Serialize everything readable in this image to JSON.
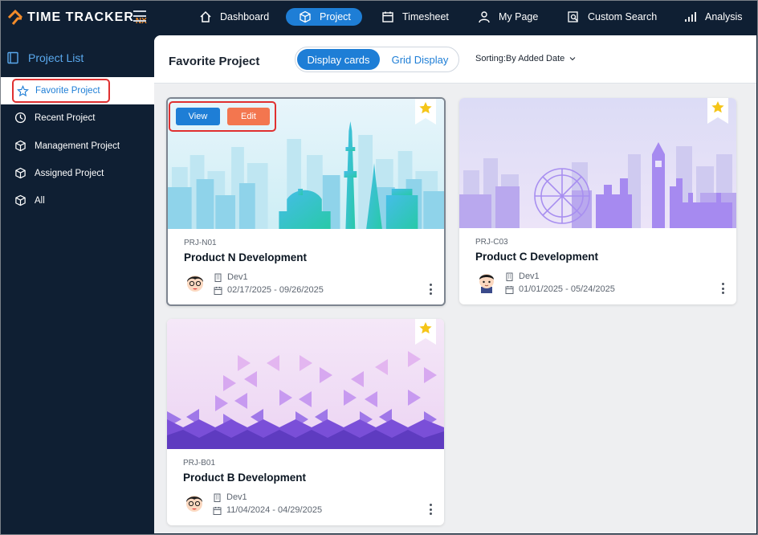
{
  "app": {
    "logo_text": "TIME TRACKER",
    "logo_suffix": "NX"
  },
  "nav": {
    "items": [
      {
        "label": "Dashboard",
        "icon": "home-icon"
      },
      {
        "label": "Project",
        "icon": "cube-icon",
        "active": true
      },
      {
        "label": "Timesheet",
        "icon": "calendar-icon"
      },
      {
        "label": "My Page",
        "icon": "user-icon"
      },
      {
        "label": "Custom Search",
        "icon": "search-doc-icon"
      },
      {
        "label": "Analysis",
        "icon": "bar-chart-icon"
      }
    ]
  },
  "sidebar": {
    "title": "Project List",
    "items": [
      {
        "label": "Favorite Project",
        "icon": "star-icon",
        "active": true
      },
      {
        "label": "Recent Project",
        "icon": "clock-icon"
      },
      {
        "label": "Management Project",
        "icon": "cube-icon"
      },
      {
        "label": "Assigned Project",
        "icon": "cube-icon"
      },
      {
        "label": "All",
        "icon": "cube-icon"
      }
    ]
  },
  "main": {
    "title": "Favorite Project",
    "view_toggle": {
      "active": "Display cards",
      "inactive": "Grid Display"
    },
    "sorting": "Sorting:By Added Date"
  },
  "cards": [
    {
      "code": "PRJ-N01",
      "name": "Product N Development",
      "team": "Dev1",
      "dates": "02/17/2025 - 09/26/2025",
      "image": "tokyo-skyline",
      "favorite": true,
      "actions": {
        "view": "View",
        "edit": "Edit"
      }
    },
    {
      "code": "PRJ-C03",
      "name": "Product C Development",
      "team": "Dev1",
      "dates": "01/01/2025 - 05/24/2025",
      "image": "london-skyline",
      "favorite": true
    },
    {
      "code": "PRJ-B01",
      "name": "Product B Development",
      "team": "Dev1",
      "dates": "11/04/2024 - 04/29/2025",
      "image": "triangle-pattern",
      "favorite": true
    }
  ],
  "colors": {
    "navy": "#0f1f33",
    "accent": "#1e7ed6",
    "edit": "#f3764f",
    "star": "#f5c518",
    "highlight": "#e03030"
  }
}
